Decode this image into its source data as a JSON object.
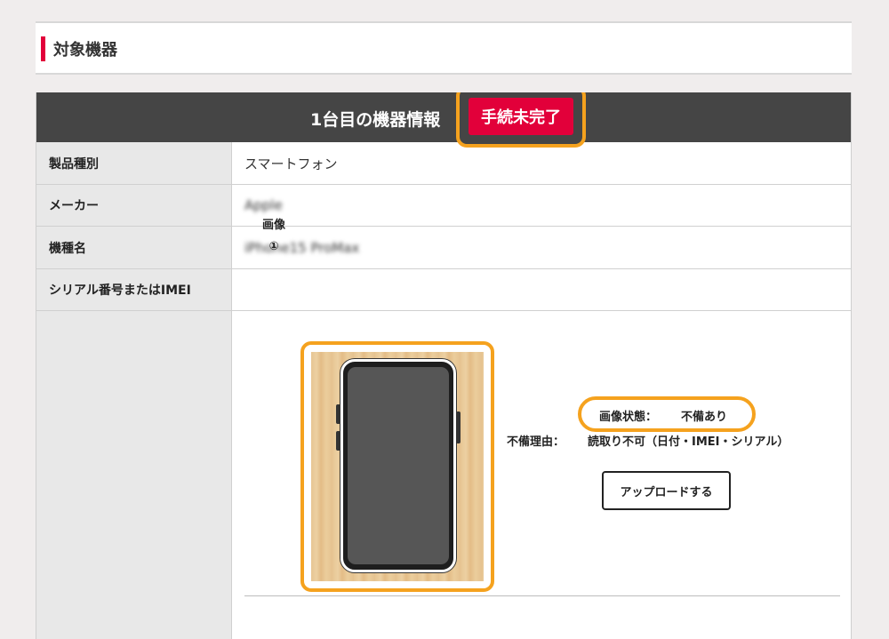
{
  "section": {
    "title": "対象機器"
  },
  "device": {
    "header_title": "1台目の機器情報",
    "status_badge": "手続未完了",
    "rows": [
      {
        "label": "製品種別",
        "value": "スマートフォン"
      },
      {
        "label": "メーカー",
        "value": "Apple"
      },
      {
        "label": "機種名",
        "value": "iPhone15 ProMax"
      },
      {
        "label": "シリアル番号またはIMEI",
        "value": ""
      }
    ],
    "image": {
      "label": "画像",
      "number": "①",
      "state_label": "画像状態：",
      "state_value": "不備あり",
      "reason_label": "不備理由：",
      "reason_value": "読取り不可（日付・IMEI・シリアル）",
      "upload_button": "アップロードする"
    }
  },
  "colors": {
    "accent": "#e2003a",
    "highlight": "#f5a21e",
    "header_bg": "#454545"
  }
}
